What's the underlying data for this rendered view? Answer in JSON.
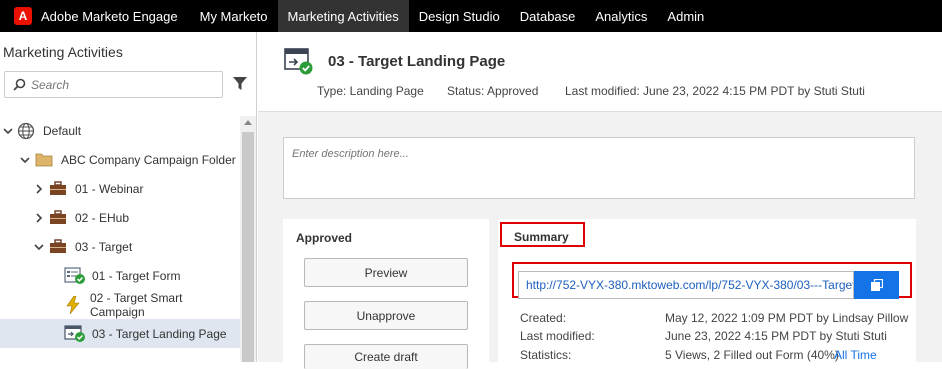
{
  "nav": {
    "brand": "Adobe Marketo Engage",
    "logo_letter": "A",
    "items": [
      {
        "label": "My Marketo"
      },
      {
        "label": "Marketing Activities"
      },
      {
        "label": "Design Studio"
      },
      {
        "label": "Database"
      },
      {
        "label": "Analytics"
      },
      {
        "label": "Admin"
      }
    ]
  },
  "sidebar": {
    "title": "Marketing Activities",
    "search_placeholder": "Search",
    "tree": [
      {
        "label": "Default",
        "icon": "globe-icon"
      },
      {
        "label": "ABC Company Campaign Folder",
        "icon": "folder-icon"
      },
      {
        "label": "01 - Webinar",
        "icon": "program-briefcase-icon"
      },
      {
        "label": "02 - EHub",
        "icon": "program-briefcase-icon"
      },
      {
        "label": "03 - Target",
        "icon": "program-briefcase-icon"
      },
      {
        "label": "01 - Target Form",
        "icon": "form-approved-icon"
      },
      {
        "label": "02 - Target Smart Campaign",
        "icon": "lightning-icon"
      },
      {
        "label": "03 - Target Landing Page",
        "icon": "landing-page-approved-icon"
      }
    ]
  },
  "page": {
    "title": "03 - Target Landing Page",
    "type": "Type: Landing Page",
    "status": "Status: Approved",
    "last_modified": "Last modified: June 23, 2022 4:15 PM PDT by Stuti Stuti",
    "description_placeholder": "Enter description here..."
  },
  "approved": {
    "title": "Approved",
    "buttons": [
      "Preview",
      "Unapprove",
      "Create draft"
    ]
  },
  "summary": {
    "title": "Summary",
    "url": "http://752-VYX-380.mktoweb.com/lp/752-VYX-380/03---Target_...",
    "rows": [
      {
        "label": "Created:",
        "value": "May 12, 2022 1:09 PM PDT by Lindsay Pillow"
      },
      {
        "label": "Last modified:",
        "value": "June 23, 2022 4:15 PM PDT by Stuti Stuti"
      },
      {
        "label": "Statistics:",
        "value": "5 Views, 2 Filled out Form (40%)"
      }
    ],
    "all_time_link": "All Time"
  },
  "colors": {
    "accent": "#1473e6",
    "highlight": "#e00000",
    "approved_green": "#2d9d3a"
  }
}
